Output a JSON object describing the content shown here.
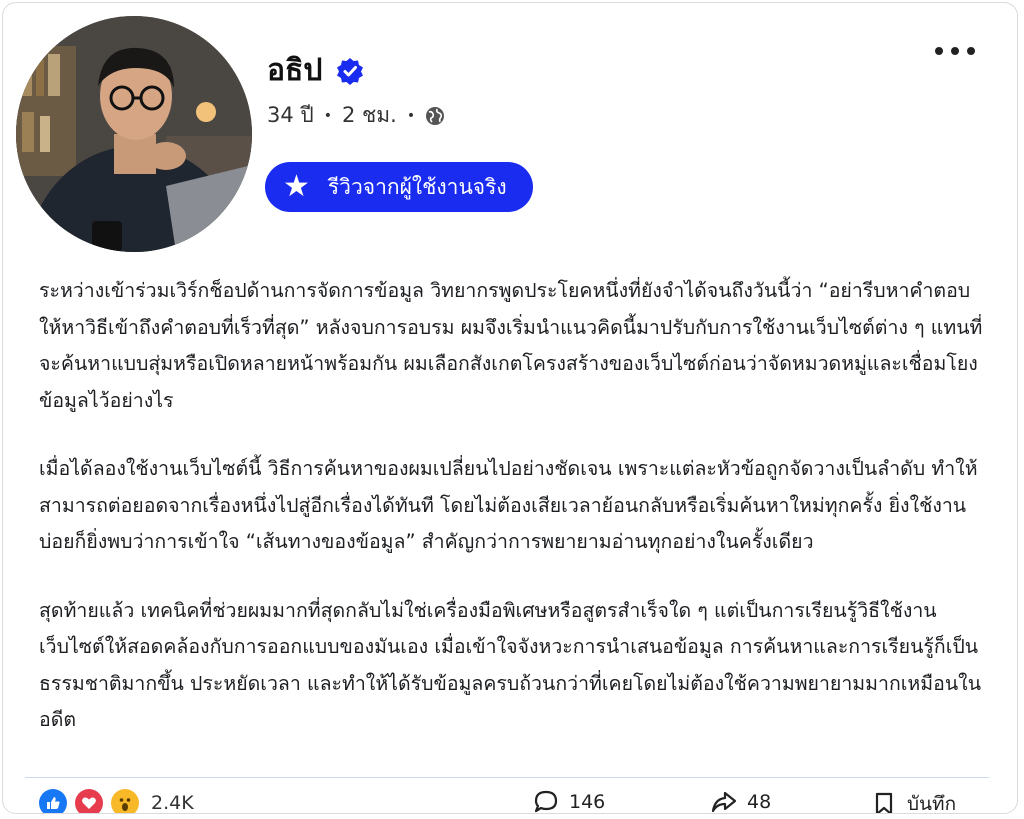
{
  "post": {
    "author": "อธิป",
    "age": "34 ปี",
    "time": "2 ชม.",
    "separator": "•",
    "badge_label": "รีวิวจากผู้ใช้งานจริง",
    "paragraphs": [
      "ระหว่างเข้าร่วมเวิร์กช็อปด้านการจัดการข้อมูล วิทยากรพูดประโยคหนึ่งที่ยังจำได้จนถึงวันนี้ว่า “อย่ารีบหาคำตอบ ให้หาวิธีเข้าถึงคำตอบที่เร็วที่สุด” หลังจบการอบรม ผมจึงเริ่มนำแนวคิดนี้มาปรับกับการใช้งานเว็บไซต์ต่าง ๆ แทนที่จะค้นหาแบบสุ่มหรือเปิดหลายหน้าพร้อมกัน ผมเลือกสังเกตโครงสร้างของเว็บไซต์ก่อนว่าจัดหมวดหมู่และเชื่อมโยงข้อมูลไว้อย่างไร",
      "เมื่อได้ลองใช้งานเว็บไซต์นี้ วิธีการค้นหาของผมเปลี่ยนไปอย่างชัดเจน เพราะแต่ละหัวข้อถูกจัดวางเป็นลำดับ ทำให้สามารถต่อยอดจากเรื่องหนึ่งไปสู่อีกเรื่องได้ทันที โดยไม่ต้องเสียเวลาย้อนกลับหรือเริ่มค้นหาใหม่ทุกครั้ง ยิ่งใช้งานบ่อยก็ยิ่งพบว่าการเข้าใจ “เส้นทางของข้อมูล” สำคัญกว่าการพยายามอ่านทุกอย่างในครั้งเดียว",
      "สุดท้ายแล้ว เทคนิคที่ช่วยผมมากที่สุดกลับไม่ใช่เครื่องมือพิเศษหรือสูตรสำเร็จใด ๆ แต่เป็นการเรียนรู้วิธีใช้งานเว็บไซต์ให้สอดคล้องกับการออกแบบของมันเอง เมื่อเข้าใจจังหวะการนำเสนอข้อมูล การค้นหาและการเรียนรู้ก็เป็นธรรมชาติมากขึ้น ประหยัดเวลา และทำให้ได้รับข้อมูลครบถ้วนกว่าที่เคยโดยไม่ต้องใช้ความพยายามมากเหมือนในอดีต"
    ]
  },
  "footer": {
    "reaction_count": "2.4K",
    "comment_count": "146",
    "share_count": "48",
    "save_label": "บันทึก"
  },
  "icons": [
    "verified-icon",
    "globe-icon",
    "more-options-icon",
    "star-icon",
    "like-icon",
    "love-icon",
    "wow-icon",
    "comment-icon",
    "share-icon",
    "bookmark-icon"
  ],
  "colors": {
    "badge": "#1a2cf0",
    "verified": "#1a2cf0",
    "like": "#1877f2",
    "love": "#e73c4e",
    "wow": "#f7b928"
  }
}
